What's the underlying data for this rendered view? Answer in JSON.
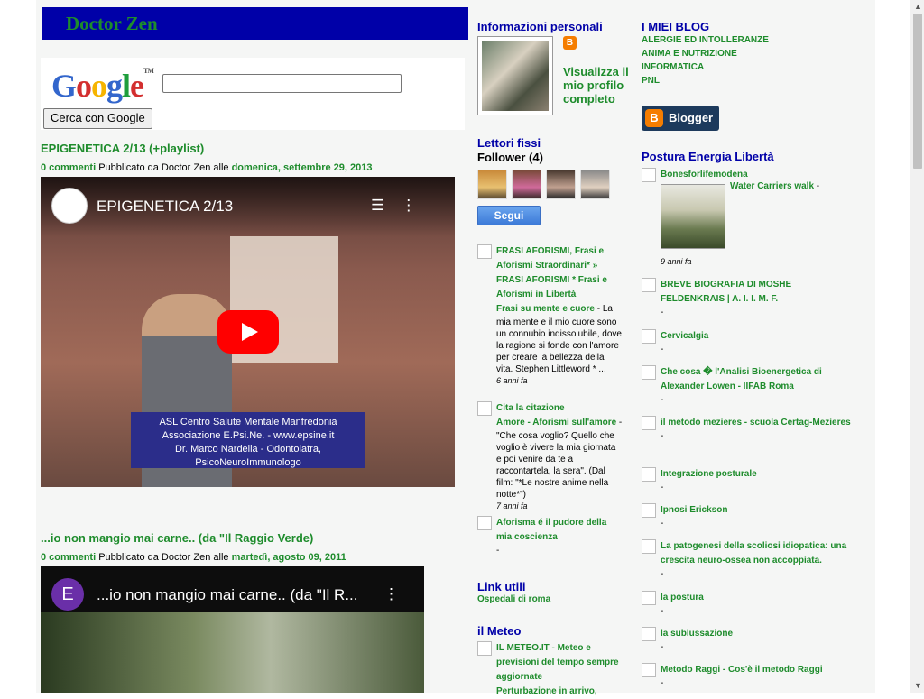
{
  "blog_title": "Doctor Zen",
  "google": {
    "logo": "Google",
    "tm": "TM",
    "search_button": "Cerca con Google"
  },
  "posts": [
    {
      "title": "EPIGENETICA 2/13 (+playlist)",
      "comments": "0 commenti",
      "published_by": "Pubblicato da Doctor Zen alle",
      "date": "domenica, settembre 29, 2013",
      "video_title": "EPIGENETICA 2/13",
      "credits": [
        "ASL Centro Salute Mentale Manfredonia",
        "Associazione E.Psi.Ne. - www.epsine.it",
        "Dr. Marco Nardella - Odontoiatra, PsicoNeuroImmunologo"
      ]
    },
    {
      "title": "...io non mangio mai carne.. (da \"Il Raggio Verde)",
      "comments": "0 commenti",
      "published_by": "Pubblicato da Doctor Zen alle",
      "date": "martedì, agosto 09, 2011",
      "video_title": "...io non mangio mai carne.. (da \"Il R...",
      "channel_initial": "E"
    }
  ],
  "profile": {
    "heading": "Informazioni personali",
    "blogger_icon": "B",
    "view_profile": "Visualizza il mio profilo completo"
  },
  "followers": {
    "heading": "Lettori fissi",
    "count_label": "Follower (4)",
    "follow_button": "Segui"
  },
  "mid_feeds": [
    {
      "title": "FRASI AFORISMI, Frasi e Aforismi Straordinari* » FRASI AFORISMI * Frasi e Aforismi in Libertà",
      "item": "Frasi su mente e cuore",
      "snippet": " - La mia mente e il mio cuore sono un connubio indissolubile, dove la ragione si fonde con l'amore per creare la bellezza della vita. Stephen Littleword * ...",
      "age": "6 anni fa"
    },
    {
      "title": "Cita la citazione",
      "item": "Amore - Aforismi sull'amore",
      "snippet": " - \"Che cosa voglio? Quello che voglio è vivere la mia giornata e poi venire da te a raccontartela, la sera\". (Dal film: \"*Le nostre anime nella notte*\")",
      "age": "7 anni fa"
    },
    {
      "title": "Aforisma é il pudore della mia coscienza",
      "item": "",
      "snippet": "-",
      "age": ""
    }
  ],
  "useful_links": {
    "heading": "Link utili",
    "items": [
      "Ospedali di roma"
    ]
  },
  "meteo": {
    "heading": "il Meteo",
    "feed_title": "IL METEO.IT - Meteo e previsioni del tempo sempre aggiornate",
    "item": "Perturbazione in arrivo,"
  },
  "my_blogs": {
    "heading": "I MIEI BLOG",
    "items": [
      "ALERGIE ED INTOLLERANZE",
      "ANIMA E NUTRIZIONE",
      "INFORMATICA",
      "PNL"
    ],
    "blogger_badge": "Blogger"
  },
  "postura": {
    "heading": "Postura Energia Libertà",
    "first": {
      "title": "Bonesforlifemodena",
      "item": "Water Carriers walk",
      "dash": "-",
      "age": "9 anni fa"
    },
    "items": [
      {
        "title": "BREVE BIOGRAFIA DI MOSHE FELDENKRAIS | A. I. I. M. F.",
        "dash": "-"
      },
      {
        "title": "Cervicalgia",
        "dash": "-"
      },
      {
        "title": "Che cosa � l'Analisi Bioenergetica di Alexander Lowen - IIFAB Roma",
        "dash": "-"
      },
      {
        "title": "il metodo mezieres - scuola Certag-Mezieres",
        "dash": "-"
      },
      {
        "title": "Integrazione posturale",
        "dash": "-"
      },
      {
        "title": "Ipnosi Erickson",
        "dash": "-"
      },
      {
        "title": "La patogenesi della scoliosi idiopatica: una crescita neuro-ossea non accoppiata.",
        "dash": "-"
      },
      {
        "title": "la postura",
        "dash": "-"
      },
      {
        "title": "la sublussazione",
        "dash": "-"
      },
      {
        "title": "Metodo Raggi - Cos'è il metodo Raggi",
        "dash": "-"
      }
    ]
  },
  "colors": {
    "header_bg": "#0000a8",
    "link_green": "#1e8c2c",
    "heading_blue": "#0000a8",
    "page_bg": "#f5f6f5"
  }
}
